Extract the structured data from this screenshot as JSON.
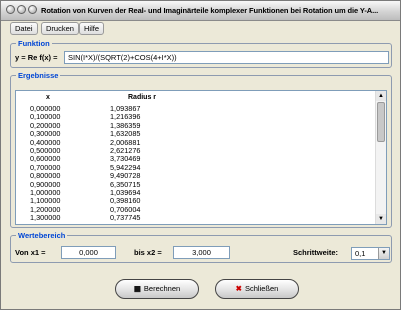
{
  "window": {
    "title": "Rotation von Kurven der Real- und Imaginärteile komplexer Funktionen bei Rotation um die Y-A..."
  },
  "menu": [
    "Datei",
    "Drucken",
    "Hilfe"
  ],
  "funktion": {
    "group_title": "Funktion",
    "label": "y = Re f(x) =",
    "value": "SIN(I*X)/(SQRT(2)+COS(4+I*X))"
  },
  "ergebnisse": {
    "group_title": "Ergebnisse",
    "col_x": "x",
    "col_r": "Radius r",
    "rows": [
      {
        "x": "0,000000",
        "r": "1,093867"
      },
      {
        "x": "0,100000",
        "r": "1,216396"
      },
      {
        "x": "0,200000",
        "r": "1,386359"
      },
      {
        "x": "0,300000",
        "r": "1,632085"
      },
      {
        "x": "0,400000",
        "r": "2,006881"
      },
      {
        "x": "0,500000",
        "r": "2,621276"
      },
      {
        "x": "0,600000",
        "r": "3,730469"
      },
      {
        "x": "0,700000",
        "r": "5,942294"
      },
      {
        "x": "0,800000",
        "r": "9,490728"
      },
      {
        "x": "0,900000",
        "r": "6,350715"
      },
      {
        "x": "1,000000",
        "r": "1,039694"
      },
      {
        "x": "1,100000",
        "r": "0,398160"
      },
      {
        "x": "1,200000",
        "r": "0,706004"
      },
      {
        "x": "1,300000",
        "r": "0,737745"
      }
    ]
  },
  "wertebereich": {
    "group_title": "Wertebereich",
    "x1_label": "Von x1 =",
    "x1_value": "0,000",
    "x2_label": "bis x2 =",
    "x2_value": "3,000",
    "step_label": "Schrittweite:",
    "step_value": "0,1"
  },
  "buttons": {
    "calc": "Berechnen",
    "close": "Schließen"
  }
}
